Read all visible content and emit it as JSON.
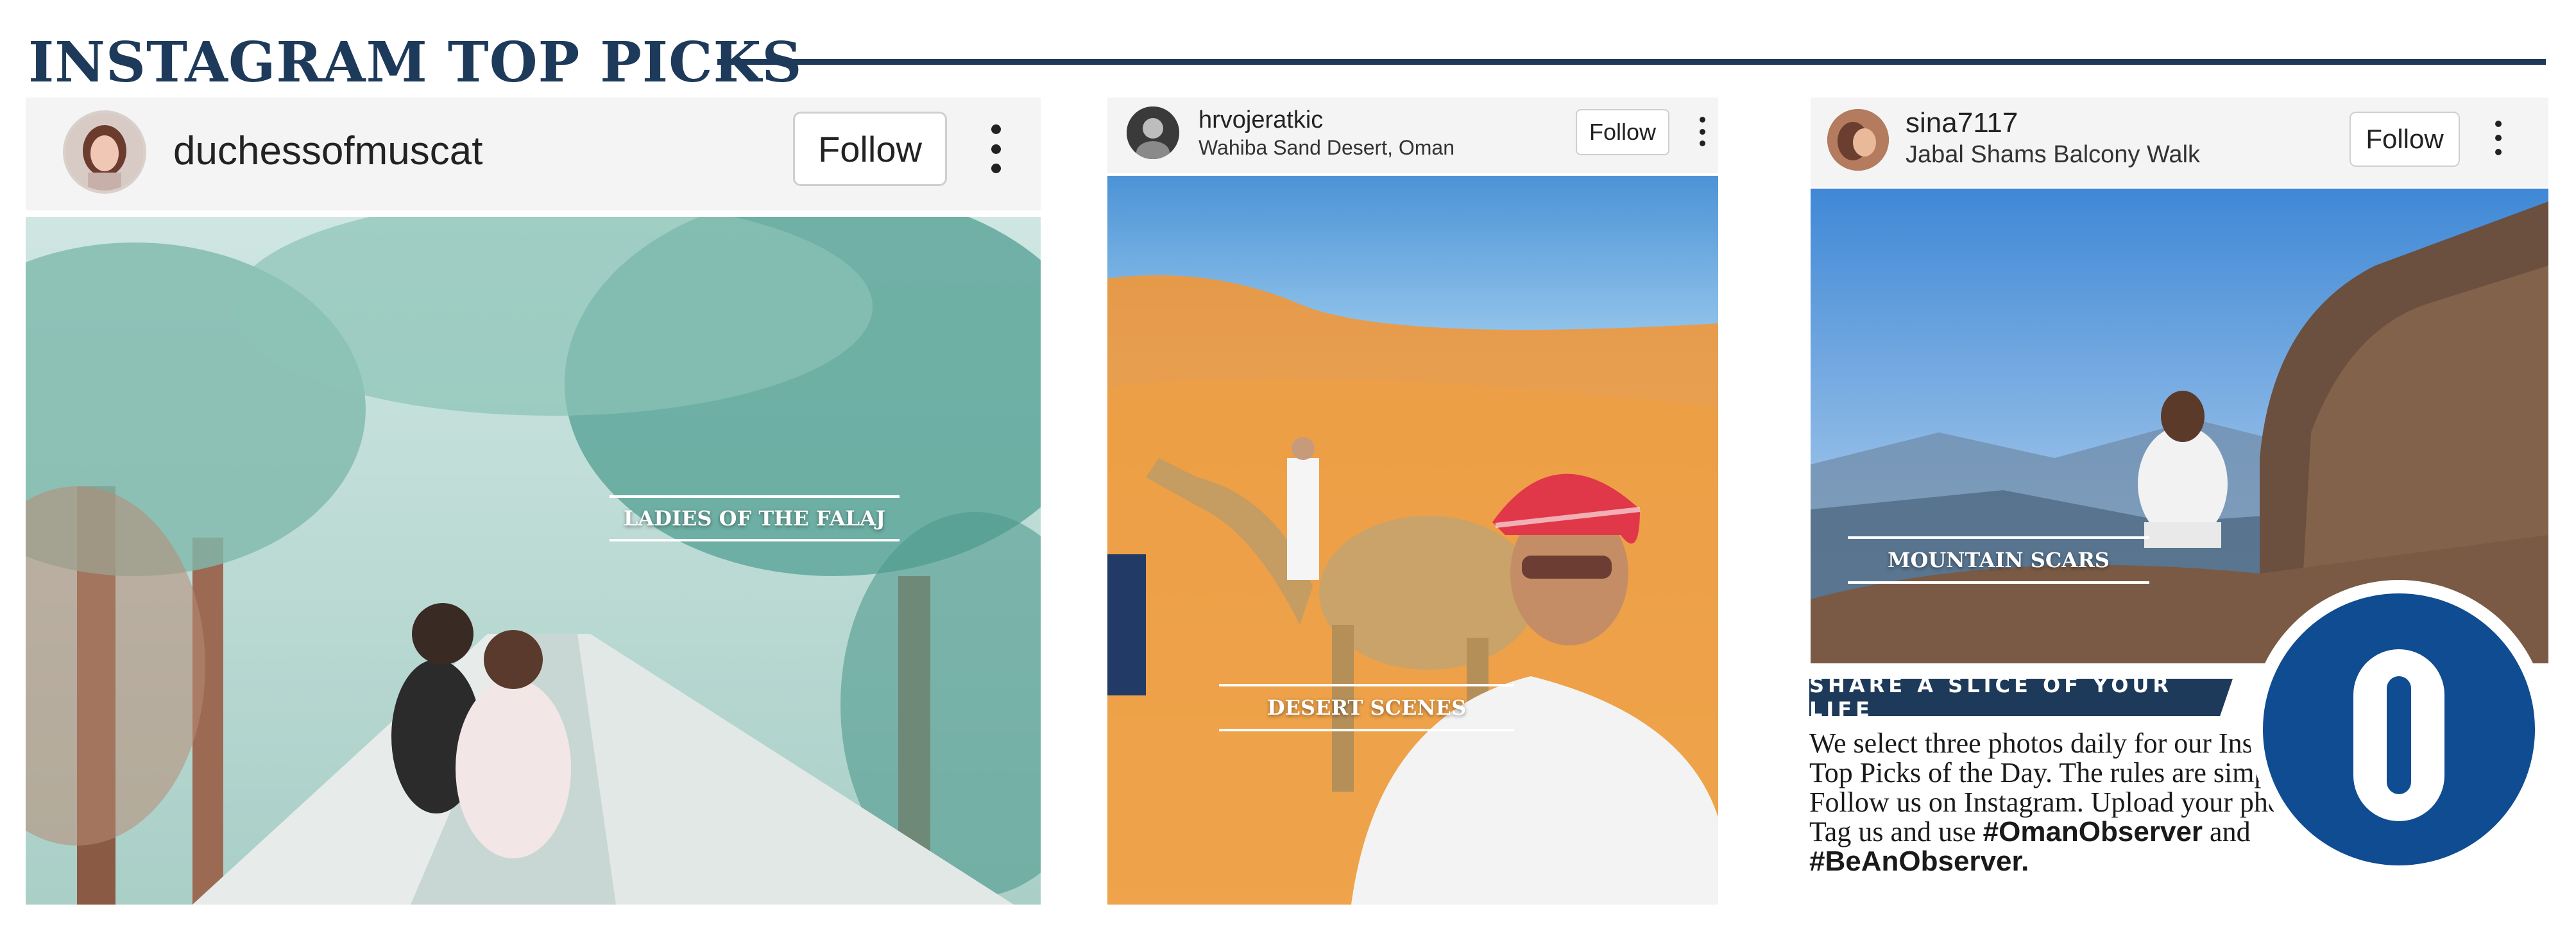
{
  "masthead": {
    "title": "INSTAGRAM TOP PICKS"
  },
  "posts": [
    {
      "username": "duchessofmuscat",
      "location": "",
      "follow_label": "Follow",
      "caption": "LADIES OF THE FALAJ"
    },
    {
      "username": "hrvojeratkic",
      "location": "Wahiba Sand Desert, Oman",
      "follow_label": "Follow",
      "caption": "DESERT SCENES"
    },
    {
      "username": "sina7117",
      "location": "Jabal Shams Balcony Walk",
      "follow_label": "Follow",
      "caption": "MOUNTAIN SCARS"
    }
  ],
  "promo": {
    "banner": "SHARE A SLICE OF YOUR LIFE",
    "body": "We select three photos daily for our Instagram Top Picks of the Day. The rules are simple. Follow us on Instagram. Upload your photos. Tag us and use",
    "hashtag1": "#OmanObserver",
    "and_word": "and",
    "hashtag2": "#BeAnObserver.",
    "logo_letter": "O"
  },
  "colors": {
    "brand_navy": "#1e3a5a",
    "logo_blue": "#0f4c92",
    "header_bg": "#f4f4f4"
  },
  "icons": {
    "more": "more-vertical-icon"
  }
}
